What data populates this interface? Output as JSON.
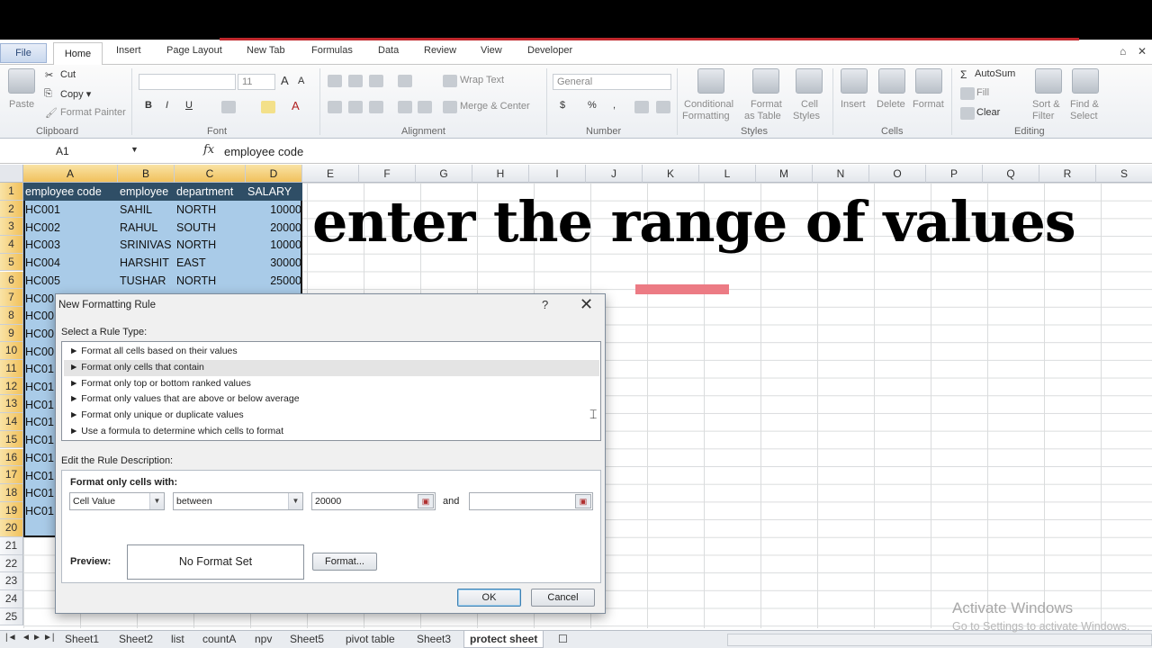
{
  "ribbon_tabs": {
    "file": "File",
    "home": "Home",
    "insert": "Insert",
    "page_layout": "Page Layout",
    "new_tab": "New Tab",
    "formulas": "Formulas",
    "data": "Data",
    "review": "Review",
    "view": "View",
    "developer": "Developer"
  },
  "ribbon": {
    "clipboard": {
      "paste": "Paste",
      "cut": "Cut",
      "copy": "Copy ▾",
      "format_painter": "Format Painter",
      "label": "Clipboard"
    },
    "font": {
      "size": "11",
      "bold": "B",
      "italic": "I",
      "underline": "U",
      "label": "Font"
    },
    "alignment": {
      "wrap_text": "Wrap Text",
      "merge_center": "Merge & Center",
      "label": "Alignment"
    },
    "number": {
      "format": "General",
      "currency": "$",
      "percent": "%",
      "comma": ",",
      "label": "Number"
    },
    "styles": {
      "conditional": "Conditional",
      "conditional2": "Formatting",
      "format_as": "Format",
      "format_as2": "as Table",
      "cell": "Cell",
      "cell2": "Styles",
      "label": "Styles"
    },
    "cells": {
      "insert": "Insert",
      "delete": "Delete",
      "format": "Format",
      "label": "Cells"
    },
    "editing": {
      "autosum": "AutoSum",
      "fill": "Fill",
      "clear": "Clear",
      "sort1": "Sort &",
      "sort2": "Filter",
      "find1": "Find &",
      "find2": "Select",
      "label": "Editing"
    }
  },
  "formula_bar": {
    "name_box": "A1",
    "fx": "fx",
    "content": "employee code"
  },
  "columns": [
    "A",
    "B",
    "C",
    "D",
    "E",
    "F",
    "G",
    "H",
    "I",
    "J",
    "K",
    "L",
    "M",
    "N",
    "O",
    "P",
    "Q",
    "R",
    "S"
  ],
  "rows": [
    "1",
    "2",
    "3",
    "4",
    "5",
    "6",
    "7",
    "8",
    "9",
    "10",
    "11",
    "12",
    "13",
    "14",
    "15",
    "16",
    "17",
    "18",
    "19",
    "20",
    "21",
    "22",
    "23",
    "24",
    "25"
  ],
  "table": {
    "headers": [
      "employee code",
      "employee",
      "department",
      "SALARY"
    ],
    "rows": [
      [
        "HC001",
        "SAHIL",
        "NORTH",
        "10000"
      ],
      [
        "HC002",
        "RAHUL",
        "SOUTH",
        "20000"
      ],
      [
        "HC003",
        "SRINIVAS",
        "NORTH",
        "10000"
      ],
      [
        "HC004",
        "HARSHIT",
        "EAST",
        "30000"
      ],
      [
        "HC005",
        "TUSHAR",
        "NORTH",
        "25000"
      ]
    ],
    "partial_col_a": [
      "HC00",
      "HC00",
      "HC00",
      "HC00",
      "HC01",
      "HC01",
      "HC01",
      "HC01",
      "HC01",
      "HC01",
      "HC01",
      "HC01",
      "HC01"
    ]
  },
  "overlay": {
    "caption": "enter the range of values"
  },
  "dialog": {
    "title": "New Formatting Rule",
    "help": "?",
    "close": "✕",
    "select_rule_label": "Select a Rule Type:",
    "rule_types": [
      "► Format all cells based on their values",
      "► Format only cells that contain",
      "► Format only top or bottom ranked values",
      "► Format only values that are above or below average",
      "► Format only unique or duplicate values",
      "► Use a formula to determine which cells to format"
    ],
    "edit_label": "Edit the Rule Description:",
    "format_only_label": "Format only cells with:",
    "cell_value": "Cell Value",
    "operator": "between",
    "value1": "20000",
    "and_label": "and",
    "value2": "",
    "preview_label": "Preview:",
    "preview_text": "No Format Set",
    "format_button": "Format...",
    "ok": "OK",
    "cancel": "Cancel"
  },
  "sheets": [
    "Sheet1",
    "Sheet2",
    "list",
    "countA",
    "npv",
    "Sheet5",
    "pivot table",
    "Sheet3",
    "protect sheet"
  ],
  "active_sheet": "protect sheet",
  "watermark": {
    "line1": "Activate Windows",
    "line2": "Go to Settings to activate Windows."
  }
}
